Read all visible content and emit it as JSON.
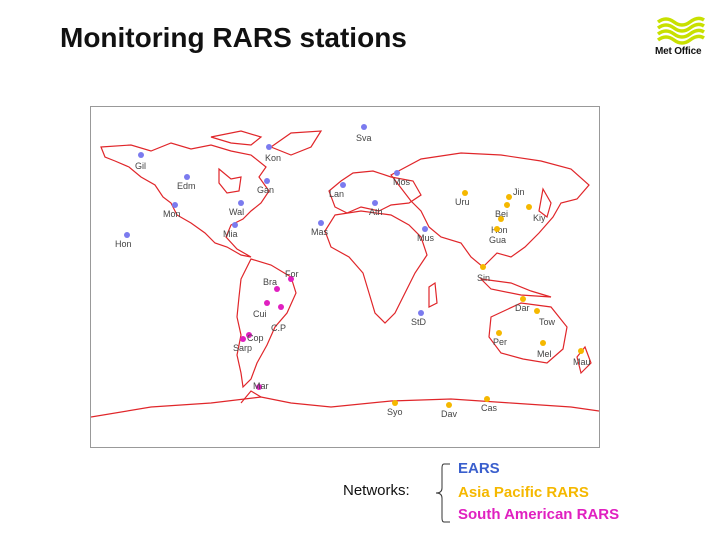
{
  "title": "Monitoring RARS stations",
  "logo": {
    "text": "Met Office",
    "color": "#c8e000"
  },
  "networks": {
    "label": "Networks:",
    "items": [
      {
        "name": "EARS",
        "color": "#3a5fcd"
      },
      {
        "name": "Asia Pacific RARS",
        "color": "#f5b800"
      },
      {
        "name": "South American RARS",
        "color": "#e020c0"
      }
    ]
  },
  "map": {
    "coastline_color": "#e0262a",
    "dot_colors": {
      "EARS": "#7b7bef",
      "Asia Pacific RARS": "#f5b800",
      "South American RARS": "#e020c0"
    }
  },
  "stations": [
    {
      "name": "Gil",
      "network": "EARS"
    },
    {
      "name": "Kon",
      "network": "EARS"
    },
    {
      "name": "Sva",
      "network": "EARS"
    },
    {
      "name": "Edm",
      "network": "EARS"
    },
    {
      "name": "Gan",
      "network": "EARS"
    },
    {
      "name": "Mos",
      "network": "EARS"
    },
    {
      "name": "Lan",
      "network": "EARS"
    },
    {
      "name": "Mon",
      "network": "EARS"
    },
    {
      "name": "Wal",
      "network": "EARS"
    },
    {
      "name": "Ath",
      "network": "EARS"
    },
    {
      "name": "Mas",
      "network": "EARS"
    },
    {
      "name": "Hon",
      "network": "EARS"
    },
    {
      "name": "Mia",
      "network": "EARS"
    },
    {
      "name": "Mus",
      "network": "EARS"
    },
    {
      "name": "StD",
      "network": "EARS"
    },
    {
      "name": "Uru",
      "network": "Asia Pacific RARS"
    },
    {
      "name": "Jin",
      "network": "Asia Pacific RARS"
    },
    {
      "name": "Bei",
      "network": "Asia Pacific RARS"
    },
    {
      "name": "Kiy",
      "network": "Asia Pacific RARS"
    },
    {
      "name": "Hon",
      "network": "Asia Pacific RARS"
    },
    {
      "name": "Gua",
      "network": "Asia Pacific RARS"
    },
    {
      "name": "Sin",
      "network": "Asia Pacific RARS"
    },
    {
      "name": "Dar",
      "network": "Asia Pacific RARS"
    },
    {
      "name": "Tow",
      "network": "Asia Pacific RARS"
    },
    {
      "name": "Per",
      "network": "Asia Pacific RARS"
    },
    {
      "name": "Mel",
      "network": "Asia Pacific RARS"
    },
    {
      "name": "Mau",
      "network": "Asia Pacific RARS"
    },
    {
      "name": "Syo",
      "network": "Asia Pacific RARS"
    },
    {
      "name": "Dav",
      "network": "Asia Pacific RARS"
    },
    {
      "name": "Cas",
      "network": "Asia Pacific RARS"
    },
    {
      "name": "For",
      "network": "South American RARS"
    },
    {
      "name": "Bra",
      "network": "South American RARS"
    },
    {
      "name": "Cui",
      "network": "South American RARS"
    },
    {
      "name": "C.P",
      "network": "South American RARS"
    },
    {
      "name": "Cop",
      "network": "South American RARS"
    },
    {
      "name": "Sarp",
      "network": "South American RARS"
    },
    {
      "name": "Mar",
      "network": "South American RARS"
    }
  ]
}
